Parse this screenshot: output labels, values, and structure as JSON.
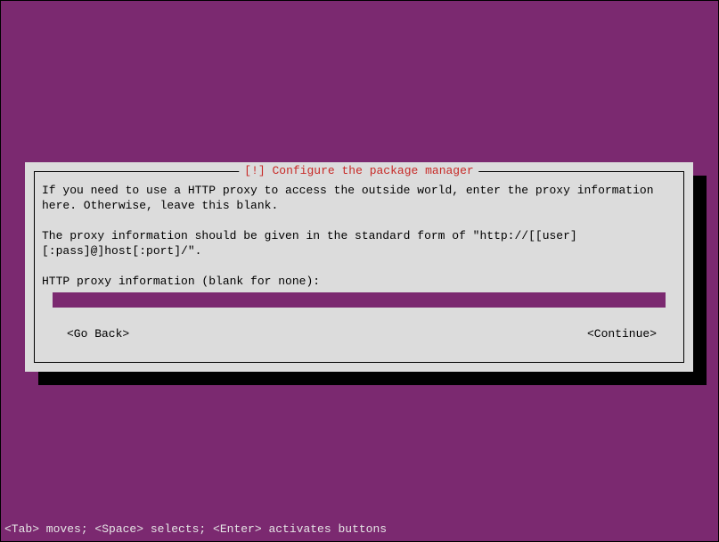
{
  "dialog": {
    "title": "[!] Configure the package manager",
    "paragraph1": "If you need to use a HTTP proxy to access the outside world, enter the proxy information here. Otherwise, leave this blank.",
    "paragraph2": "The proxy information should be given in the standard form of \"http://[[user][:pass]@]host[:port]/\".",
    "prompt": "HTTP proxy information (blank for none):",
    "input_value": "",
    "go_back": "<Go Back>",
    "continue": "<Continue>"
  },
  "status_bar": "<Tab> moves; <Space> selects; <Enter> activates buttons"
}
